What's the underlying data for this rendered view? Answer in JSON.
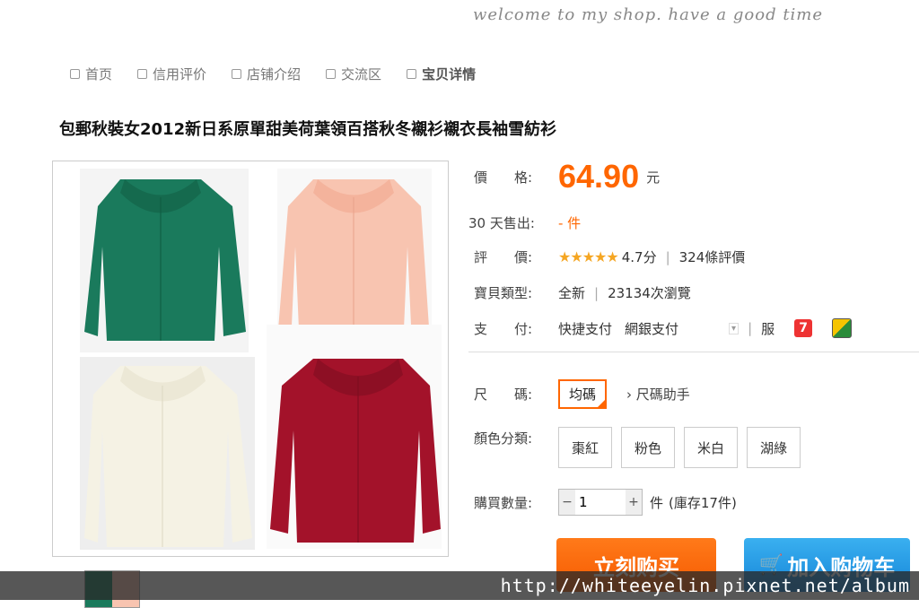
{
  "header": {
    "welcome": "welcome to my shop. have a good time"
  },
  "nav": {
    "items": [
      {
        "label": "首页"
      },
      {
        "label": "信用评价"
      },
      {
        "label": "店铺介绍"
      },
      {
        "label": "交流区"
      },
      {
        "label": "宝贝详情"
      }
    ]
  },
  "product": {
    "title": "包郵秋裝女2012新日系原單甜美荷葉領百搭秋冬襯衫襯衣長袖雪紡衫",
    "image_colors": [
      "#1a7a5c",
      "#f8c4b0",
      "#f5f2e4",
      "#a3122a"
    ]
  },
  "info": {
    "price_label": "價　　格:",
    "price": "64.90",
    "price_unit": "元",
    "sold_label": "30 天售出:",
    "sold_value": "- 件",
    "rating_label": "評　　價:",
    "stars": "★★★★★",
    "rating": "4.7分",
    "reviews": "324條評價",
    "type_label": "寶貝類型:",
    "type_value": "全新",
    "views": "23134次瀏覽",
    "pay_label": "支　　付:",
    "pay_option1": "快捷支付",
    "pay_option2": "網銀支付",
    "service": "服"
  },
  "options": {
    "size_label": "尺　　碼:",
    "size_value": "均碼",
    "size_help": "尺碼助手",
    "color_label": "顏色分類:",
    "colors": [
      "棗紅",
      "粉色",
      "米白",
      "湖綠"
    ],
    "qty_label": "購買數量:",
    "qty_value": "1",
    "qty_unit": "件",
    "stock": "(庫存17件)"
  },
  "actions": {
    "buy_now": "立刻购买",
    "add_cart": "加入购物车"
  },
  "watermark": "http://whiteeyelin.pixnet.net/album"
}
